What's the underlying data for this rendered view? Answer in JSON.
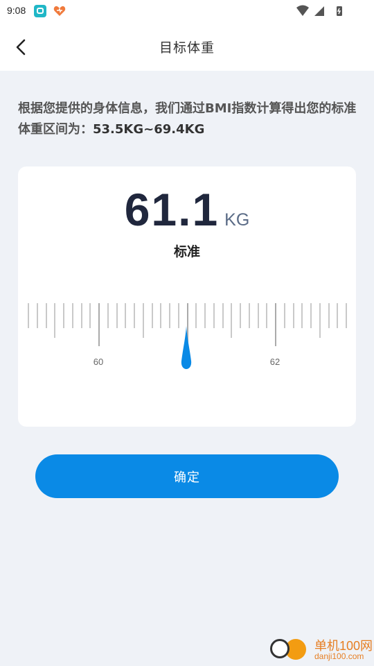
{
  "status_bar": {
    "time": "9:08"
  },
  "header": {
    "title": "目标体重"
  },
  "intro": {
    "text": "根据您提供的身体信息，我们通过BMI指数计算得出您的标准体重区间为：",
    "range": "53.5KG~69.4KG"
  },
  "weight": {
    "value": "61.1",
    "unit": "KG",
    "status": "标准"
  },
  "ruler": {
    "labels": [
      "60",
      "62"
    ]
  },
  "confirm_label": "确定",
  "watermark": {
    "title": "单机100网",
    "sub": "danji100.com"
  },
  "colors": {
    "accent": "#0a8ae6",
    "value_text": "#20273d",
    "background": "#eff2f7"
  }
}
